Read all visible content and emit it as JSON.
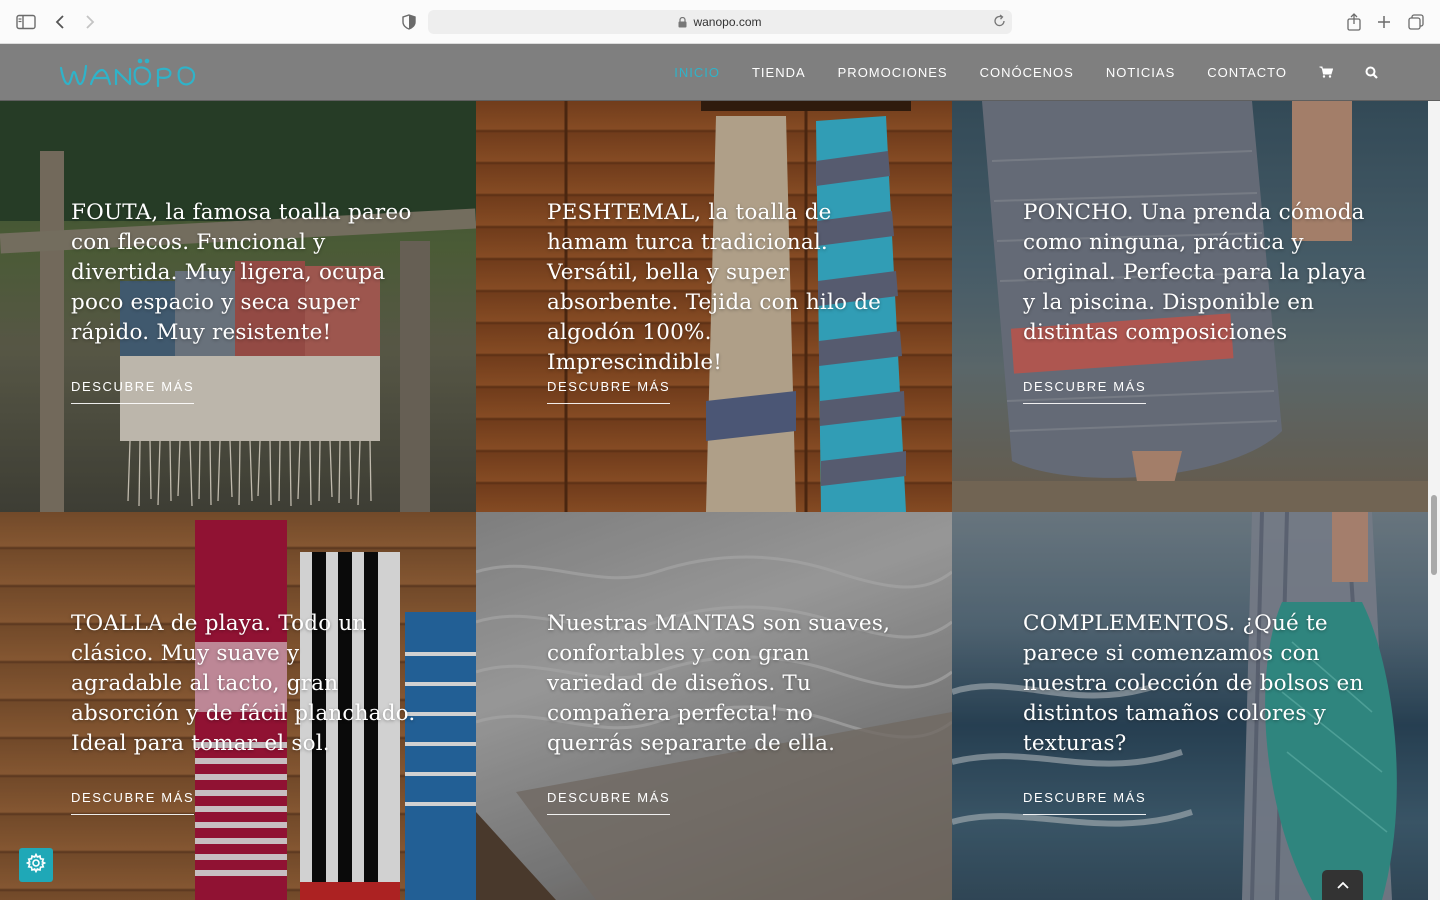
{
  "browser": {
    "url": "wanopo.com"
  },
  "site": {
    "logo_text": "WANOPO",
    "brand_color": "#2fb3c9",
    "nav": [
      {
        "label": "INICIO",
        "active": true
      },
      {
        "label": "TIENDA"
      },
      {
        "label": "PROMOCIONES"
      },
      {
        "label": "CONÓCENOS"
      },
      {
        "label": "NOTICIAS"
      },
      {
        "label": "CONTACTO"
      }
    ],
    "nav_icons": [
      "cart-icon",
      "search-icon"
    ]
  },
  "tiles": [
    {
      "caption": "FOUTA, la famosa toalla pareo con flecos. Funcional y divertida. Muy ligera, ocupa poco espacio y seca super rápido. Muy resistente!",
      "cta": "DESCUBRE MÁS"
    },
    {
      "caption": "PESHTEMAL, la toalla de hamam turca tradicional. Versátil, bella y super absorbente. Tejida con hilo de algodón 100%. Imprescindible!",
      "cta": "DESCUBRE MÁS"
    },
    {
      "caption": "PONCHO. Una prenda cómoda como ninguna, práctica y original. Perfecta para la playa y la piscina. Disponible en distintas composiciones",
      "cta": "DESCUBRE MÁS"
    },
    {
      "caption": "TOALLA de playa. Todo un clásico. Muy suave y agradable al tacto, gran absorción y de fácil planchado. Ideal para tomar el sol.",
      "cta": "DESCUBRE MÁS"
    },
    {
      "caption": "Nuestras MANTAS son suaves, confortables y con gran variedad de diseños. Tu compañera perfecta! no querrás separarte de ella.",
      "cta": "DESCUBRE MÁS"
    },
    {
      "caption": "COMPLEMENTOS. ¿Qué te parece si comenzamos con nuestra colección de bolsos en distintos tamaños colores y texturas?",
      "cta": "DESCUBRE MÁS"
    }
  ],
  "widgets": {
    "settings_icon": "gear-icon",
    "to_top_icon": "chevron-up-icon"
  }
}
